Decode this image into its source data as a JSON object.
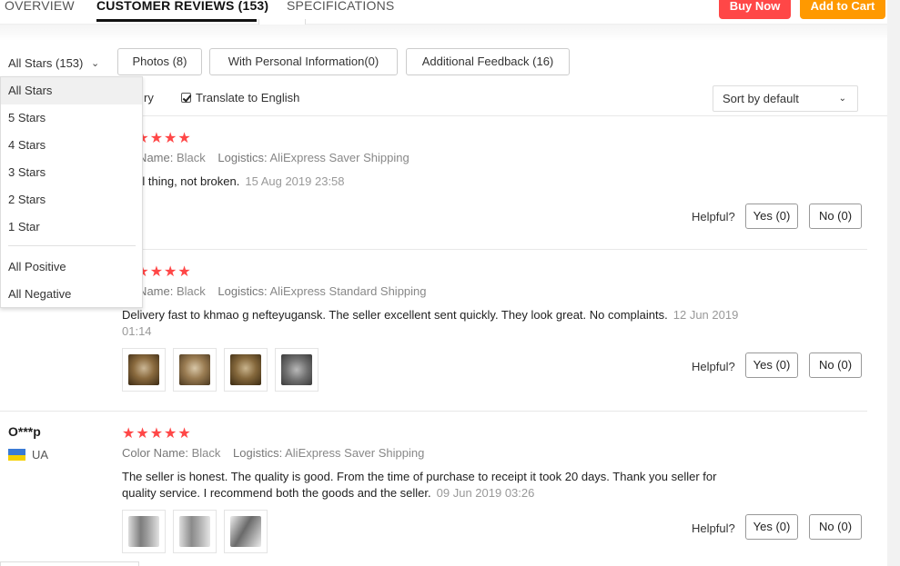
{
  "tabs": [
    {
      "label": "OVERVIEW"
    },
    {
      "label": "CUSTOMER REVIEWS (153)"
    },
    {
      "label": "SPECIFICATIONS"
    }
  ],
  "actions": {
    "buy_now": "Buy Now",
    "add_to_cart": "Add to Cart"
  },
  "filters": {
    "stars_selected": "All Stars (153)",
    "photos": "Photos (8)",
    "personal_info": "With Personal Information(0)",
    "additional_feedback": "Additional Feedback (16)"
  },
  "options": {
    "country_fragment": "ry",
    "translate_label": "Translate to English",
    "translate_checked": true,
    "sort_label": "Sort by default"
  },
  "star_menu": {
    "items": [
      "All Stars",
      "5 Stars",
      "4 Stars",
      "3 Stars",
      "2 Stars",
      "1 Star"
    ],
    "extra": [
      "All Positive",
      "All Negative"
    ],
    "active": "All Stars"
  },
  "reviews": [
    {
      "stars": "★★★★★",
      "color_label": "lor Name:",
      "color_value": "Black",
      "logistics_label": "Logistics:",
      "logistics_value": "AliExpress Saver Shipping",
      "text": "rmal thing, not broken.",
      "date": "15 Aug 2019 23:58",
      "helpful": "Helpful?",
      "yes": "Yes (0)",
      "no": "No (0)"
    },
    {
      "stars": "★★★★★",
      "color_label": "lor Name:",
      "color_value": "Black",
      "logistics_label": "Logistics:",
      "logistics_value": "AliExpress Standard Shipping",
      "text": "Delivery fast to khmao g nefteyugansk. The seller excellent sent quickly. They look great. No complaints.",
      "date": "12 Jun 2019",
      "date2": "01:14",
      "helpful": "Helpful?",
      "yes": "Yes (0)",
      "no": "No (0)"
    },
    {
      "user": "O***p",
      "country": "UA",
      "stars": "★★★★★",
      "color_label": "Color Name:",
      "color_value": "Black",
      "logistics_label": "Logistics:",
      "logistics_value": "AliExpress Saver Shipping",
      "text_line1": "The seller is honest. The quality is good. From the time of purchase to receipt it took 20 days. Thank you seller for",
      "text_line2": "quality service. I recommend both the goods and the seller.",
      "date": "09 Jun 2019 03:26",
      "helpful": "Helpful?",
      "yes": "Yes (0)",
      "no": "No (0)"
    }
  ]
}
